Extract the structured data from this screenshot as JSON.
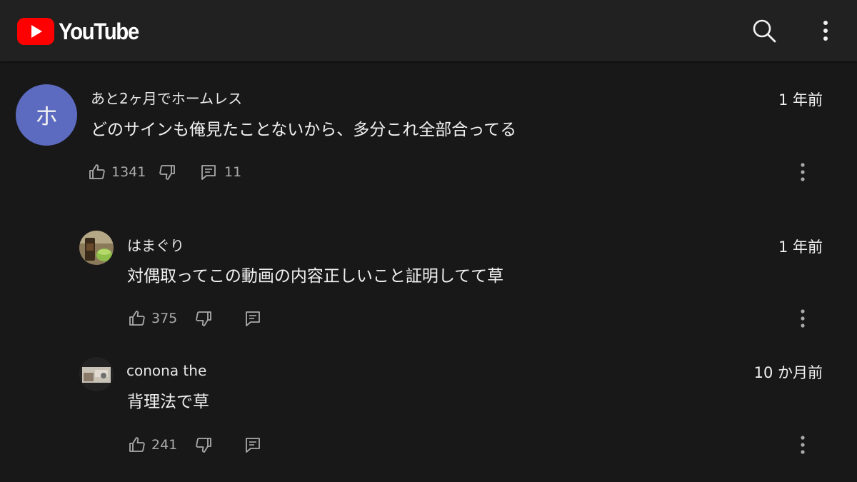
{
  "header": {
    "logo_text": "YouTube",
    "brand_color": "#ff0000",
    "icons": [
      "youtube-logo-icon",
      "search-icon",
      "more-vert-icon"
    ]
  },
  "comments": [
    {
      "author": "あと2ヶ月でホームレス",
      "avatar_letter": "ホ",
      "avatar_color": "#5c6bc0",
      "time": "1 年前",
      "text": "どのサインも俺見たことないから、多分これ全部合ってる",
      "likes": "1341",
      "replies": "11"
    },
    {
      "author": "はまぐり",
      "time": "1 年前",
      "text": "対偶取ってこの動画の内容正しいこと証明してて草",
      "likes": "375"
    },
    {
      "author": "conona the",
      "time": "10 か月前",
      "text": "背理法で草",
      "likes": "241"
    }
  ]
}
